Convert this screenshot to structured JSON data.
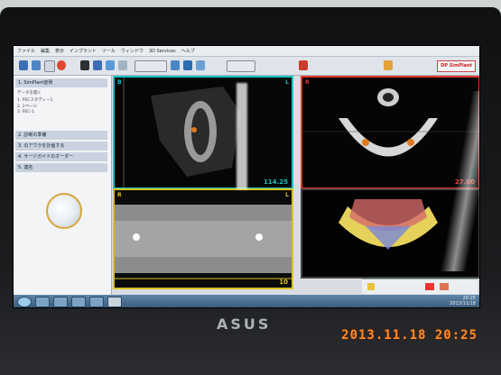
{
  "app": {
    "menu": [
      "ファイル",
      "編集",
      "表示",
      "インプラント",
      "ツール",
      "ウィンドウ",
      "3D Services",
      "ヘルプ"
    ],
    "logo_text": "DP SimPlant"
  },
  "sidebar": {
    "sections": [
      {
        "label": "1. SimPlant症例"
      },
      {
        "label": "2. 診断の準備"
      },
      {
        "label": "3. のアウラを計画する"
      },
      {
        "label": "4. サージガイドのオーダー"
      },
      {
        "label": "5. 連名"
      }
    ],
    "item_lines": [
      "データを開く",
      "1. PECスタディー1",
      "2. 2ページ",
      "3. PEC-1"
    ]
  },
  "viewports": {
    "axial_letter_left": "B",
    "axial_letter_right": "L",
    "axial_value": "114.25",
    "top_right_letter": "R",
    "top_right_value": "27.00",
    "pano_letter_left": "R",
    "pano_letter_right": "L",
    "pano_value": "10"
  },
  "taskbar": {
    "clock_time": "20:25",
    "clock_date": "2013/11/18"
  },
  "laptop": {
    "brand": "ASUS"
  },
  "photo": {
    "timestamp": "2013.11.18 20:25"
  },
  "colors": {
    "cyan_frame": "#19c4c4",
    "red_frame": "#e03a2a",
    "yellow_frame": "#d8c21c",
    "timestamp": "#ff8a2a"
  }
}
